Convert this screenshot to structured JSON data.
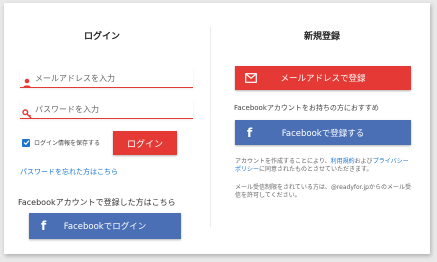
{
  "login": {
    "title": "ログイン",
    "email_placeholder": "メールアドレスを入力",
    "password_placeholder": "パスワードを入力",
    "remember_label": "ログイン情報を保存する",
    "remember_checked": true,
    "login_button": "ログイン",
    "forgot_link": "パスワードを忘れた方はこちら",
    "facebook_lead": "Facebookアカウントで登録した方はこちら",
    "facebook_button": "Facebookでログイン"
  },
  "register": {
    "title": "新規登録",
    "email_button": "メールアドレスで登録",
    "facebook_lead": "Facebookアカウントをお持ちの方におすすめ",
    "facebook_button": "Facebookで登録する",
    "terms_prefix": "アカウントを作成することにより、",
    "terms_link": "利用規約",
    "terms_and": "および",
    "privacy_link": "プライバシーポリシー",
    "terms_suffix": "に同意されたものとさせていただきます。",
    "mail_note": "メール受信制限をされている方は、@readyfor.jpからのメール受信を許可してください。"
  },
  "icons": {
    "user": "user-icon",
    "key": "key-icon",
    "mail": "mail-icon",
    "facebook": "facebook-icon"
  },
  "colors": {
    "accent_red": "#e53935",
    "facebook_blue": "#4a6fb5",
    "link_blue": "#1976d2"
  }
}
